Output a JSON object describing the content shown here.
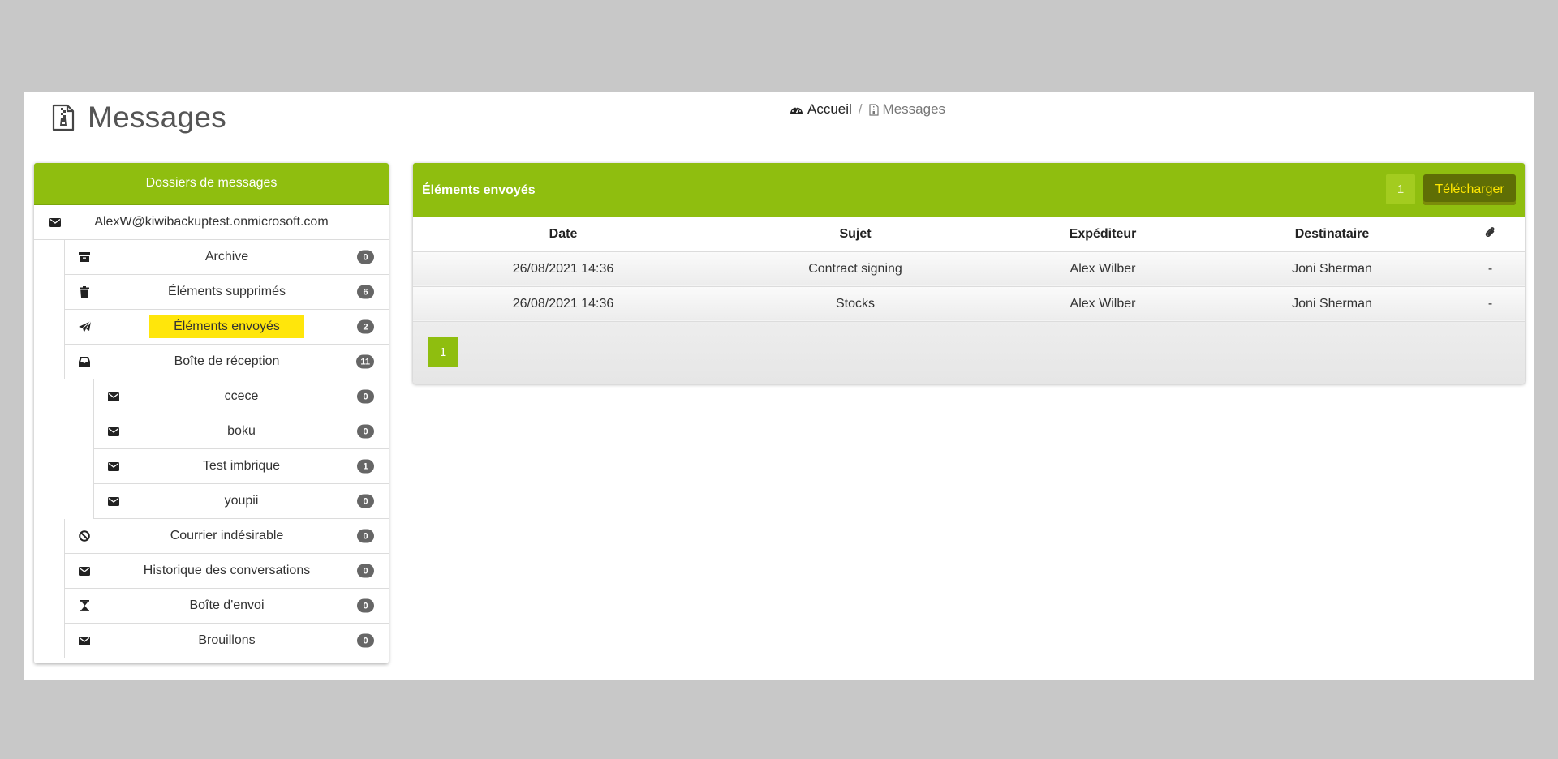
{
  "page": {
    "title": "Messages",
    "title_icon": "file-zipper-icon"
  },
  "breadcrumb": {
    "home_label": "Accueil",
    "home_icon": "dashboard-gauge-icon",
    "separator": "/",
    "current_label": "Messages",
    "current_icon": "file-zipper-icon"
  },
  "sidebar": {
    "header": "Dossiers de messages",
    "account": {
      "label": "AlexW@kiwibackuptest.onmicrosoft.com",
      "icon": "envelope-icon"
    },
    "folders": [
      {
        "label": "Archive",
        "count": "0",
        "icon": "archive-box-icon"
      },
      {
        "label": "Éléments supprimés",
        "count": "6",
        "icon": "trash-icon"
      },
      {
        "label": "Éléments envoyés",
        "count": "2",
        "icon": "paper-plane-icon",
        "selected": true
      },
      {
        "label": "Boîte de réception",
        "count": "11",
        "icon": "inbox-icon"
      },
      {
        "label": "ccece",
        "count": "0",
        "icon": "envelope-icon"
      },
      {
        "label": "boku",
        "count": "0",
        "icon": "envelope-icon"
      },
      {
        "label": "Test imbrique",
        "count": "1",
        "icon": "envelope-icon"
      },
      {
        "label": "youpii",
        "count": "0",
        "icon": "envelope-icon"
      },
      {
        "label": "Courrier indésirable",
        "count": "0",
        "icon": "ban-icon"
      },
      {
        "label": "Historique des conversations",
        "count": "0",
        "icon": "envelope-icon"
      },
      {
        "label": "Boîte d'envoi",
        "count": "0",
        "icon": "hourglass-icon"
      },
      {
        "label": "Brouillons",
        "count": "0",
        "icon": "envelope-icon"
      }
    ]
  },
  "panel": {
    "title": "Éléments envoyés",
    "count": "1",
    "download_label": "Télécharger",
    "columns": {
      "date": "Date",
      "subject": "Sujet",
      "sender": "Expéditeur",
      "recipient": "Destinataire",
      "attachment_icon": "paperclip-icon"
    },
    "rows": [
      {
        "date": "26/08/2021 14:36",
        "subject": "Contract signing",
        "sender": "Alex Wilber",
        "recipient": "Joni Sherman",
        "attachment": "-"
      },
      {
        "date": "26/08/2021 14:36",
        "subject": "Stocks",
        "sender": "Alex Wilber",
        "recipient": "Joni Sherman",
        "attachment": "-"
      }
    ],
    "pagination": {
      "current_page": "1"
    }
  },
  "colors": {
    "accent_green": "#8fbe0f",
    "highlight_yellow": "#ffe60b",
    "download_button_bg": "#5f6e05",
    "download_button_text": "#ffe600",
    "badge_gray": "#666666",
    "outer_background": "#c8c8c8"
  }
}
